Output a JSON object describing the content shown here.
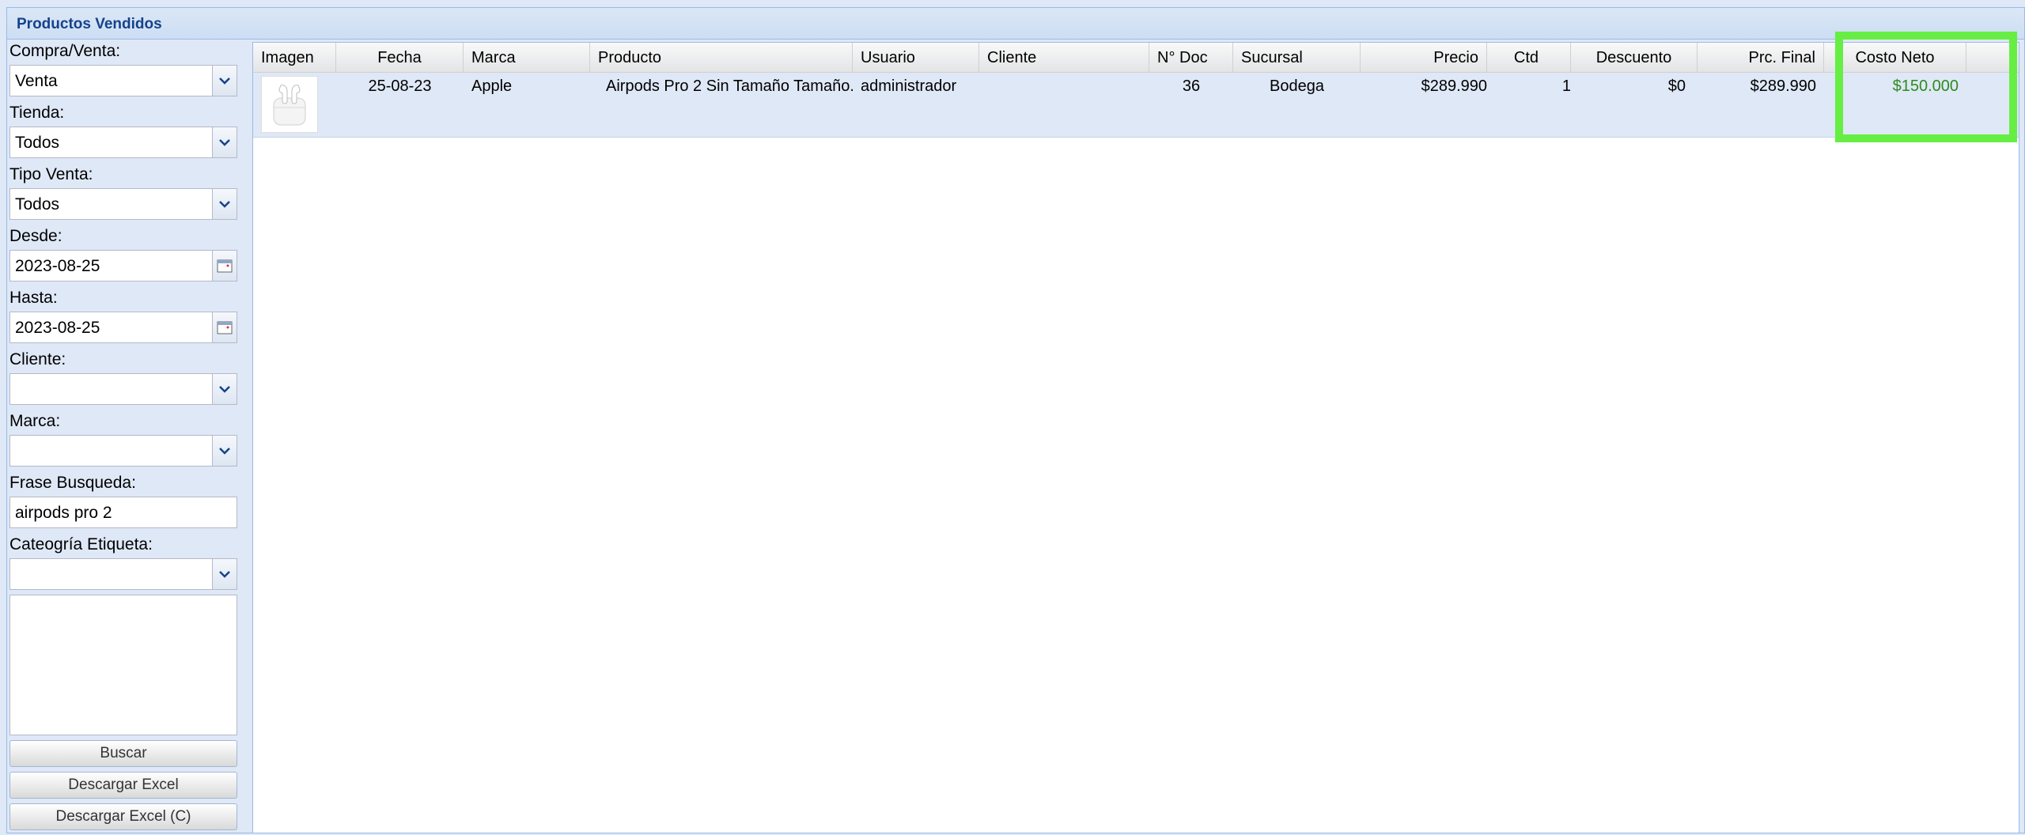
{
  "panel": {
    "title": "Productos Vendidos"
  },
  "filters": {
    "compra_venta": {
      "label": "Compra/Venta:",
      "value": "Venta"
    },
    "tienda": {
      "label": "Tienda:",
      "value": "Todos"
    },
    "tipo_venta": {
      "label": "Tipo Venta:",
      "value": "Todos"
    },
    "desde": {
      "label": "Desde:",
      "value": "2023-08-25"
    },
    "hasta": {
      "label": "Hasta:",
      "value": "2023-08-25"
    },
    "cliente": {
      "label": "Cliente:",
      "value": ""
    },
    "marca": {
      "label": "Marca:",
      "value": ""
    },
    "frase": {
      "label": "Frase Busqueda:",
      "value": "airpods pro 2"
    },
    "categoria": {
      "label": "Cateogría Etiqueta:",
      "value": ""
    }
  },
  "buttons": {
    "buscar": "Buscar",
    "excel": "Descargar Excel",
    "excel_c": "Descargar Excel (C)"
  },
  "grid": {
    "columns": [
      "Imagen",
      "Fecha",
      "Marca",
      "Producto",
      "Usuario",
      "Cliente",
      "N° Doc",
      "Sucursal",
      "Precio",
      "Ctd",
      "Descuento",
      "Prc. Final",
      "Costo Neto"
    ],
    "rows": [
      {
        "fecha": "25-08-23",
        "marca": "Apple",
        "producto": "Airpods Pro 2 Sin Tamaño Tamaño...",
        "usuario": "administrador",
        "cliente": "",
        "doc": "36",
        "sucursal": "Bodega",
        "precio": "$289.990",
        "ctd": "1",
        "descuento": "$0",
        "prc_final": "$289.990",
        "costo_neto": "$150.000"
      }
    ]
  },
  "colors": {
    "costo_neto": "#2e8b1e",
    "highlight": "#66ee44"
  }
}
